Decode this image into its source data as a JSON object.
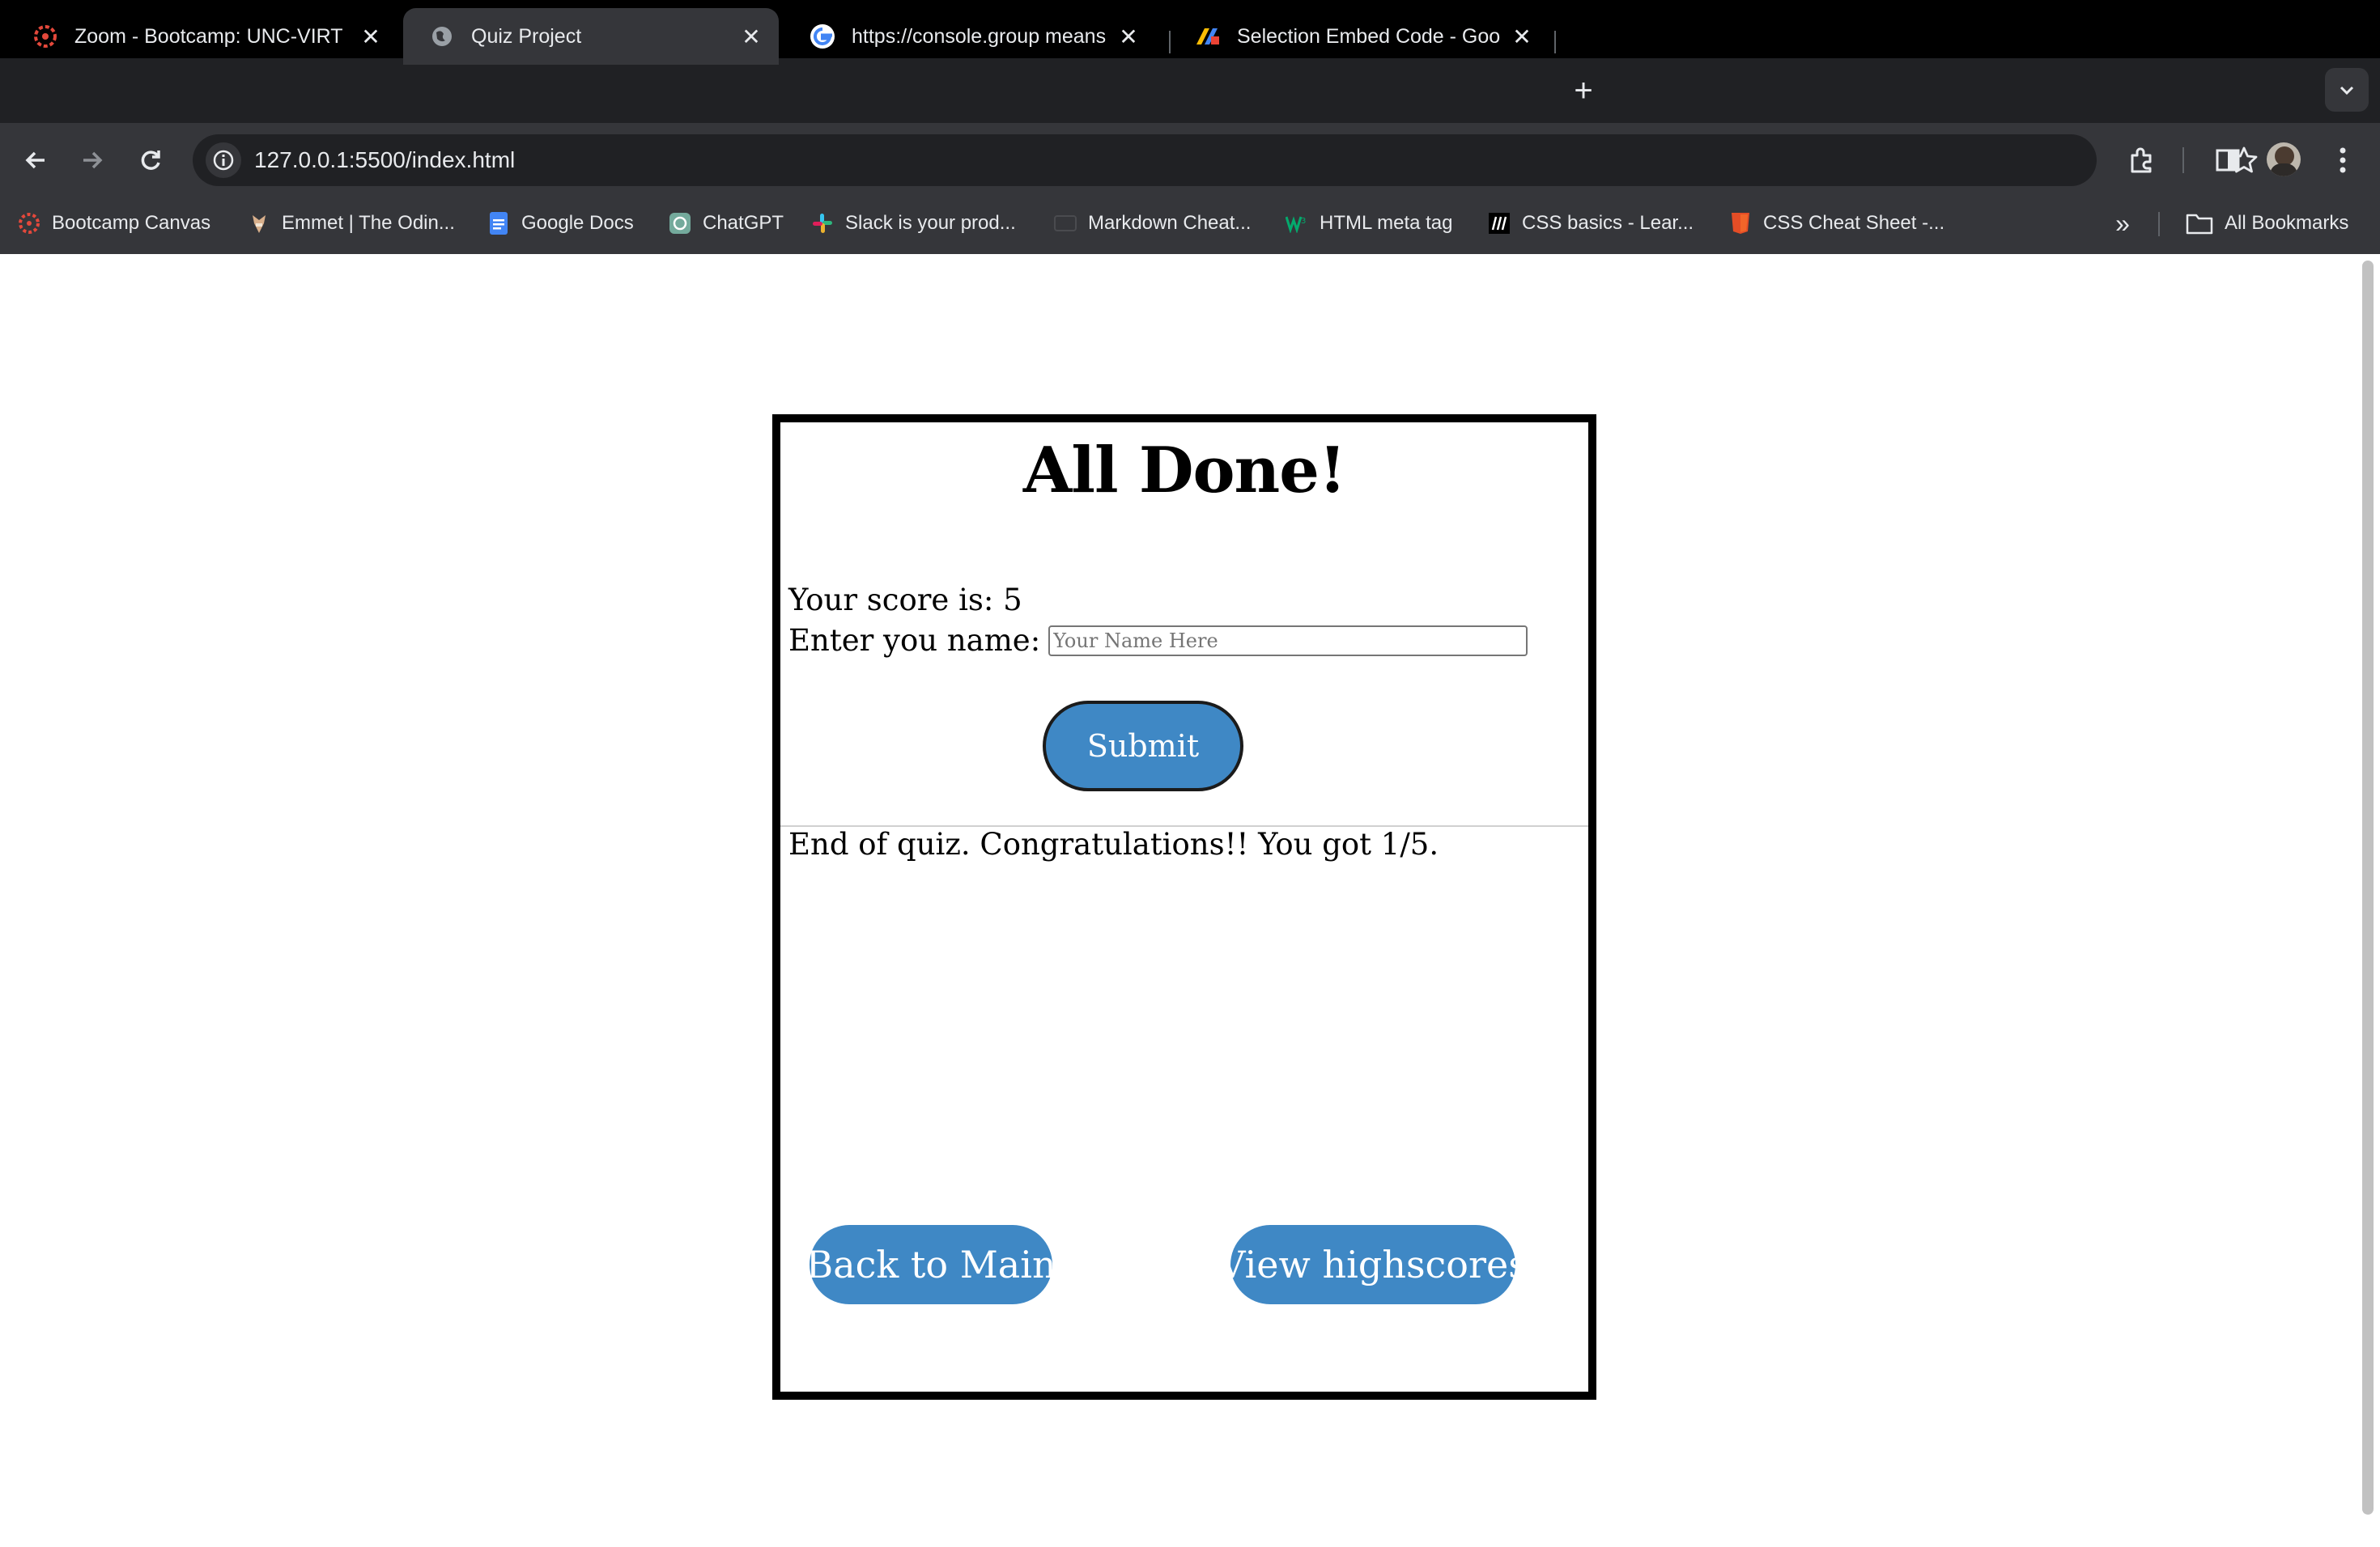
{
  "tabs": [
    {
      "title": "Zoom - Bootcamp: UNC-VIRT",
      "icon": "zoom-logo-icon",
      "active": false
    },
    {
      "title": "Quiz Project",
      "icon": "globe-icon",
      "active": true
    },
    {
      "title": "https://console.group means",
      "icon": "google-logo-icon",
      "active": false
    },
    {
      "title": "Selection Embed Code - Goo",
      "icon": "app-logo-icon",
      "active": false
    }
  ],
  "address_bar": {
    "url": "127.0.0.1:5500/index.html"
  },
  "bookmarks": [
    {
      "label": "Bootcamp Canvas",
      "icon": "canvas-logo-icon"
    },
    {
      "label": "Emmet | The Odin...",
      "icon": "odin-logo-icon"
    },
    {
      "label": "Google Docs",
      "icon": "google-docs-icon"
    },
    {
      "label": "ChatGPT",
      "icon": "chatgpt-icon"
    },
    {
      "label": "Slack is your prod...",
      "icon": "slack-icon"
    },
    {
      "label": "Markdown Cheat...",
      "icon": "markdown-icon"
    },
    {
      "label": "HTML meta tag",
      "icon": "w3schools-icon"
    },
    {
      "label": "CSS basics - Lear...",
      "icon": "mdn-icon"
    },
    {
      "label": "CSS Cheat Sheet -...",
      "icon": "html5-icon"
    }
  ],
  "all_bookmarks_label": "All Bookmarks",
  "quiz": {
    "heading": "All Done!",
    "score_text": "Your score is: 5",
    "name_label": "Enter you name:",
    "name_placeholder": "Your Name Here",
    "submit_label": "Submit",
    "end_message": "End of quiz. Congratulations!! You got 1/5.",
    "back_label": "Back to Main",
    "highscores_label": "View highscores"
  },
  "colors": {
    "button_blue": "#3f88c5",
    "chrome_dark": "#202124",
    "chrome_toolbar": "#35363a"
  }
}
